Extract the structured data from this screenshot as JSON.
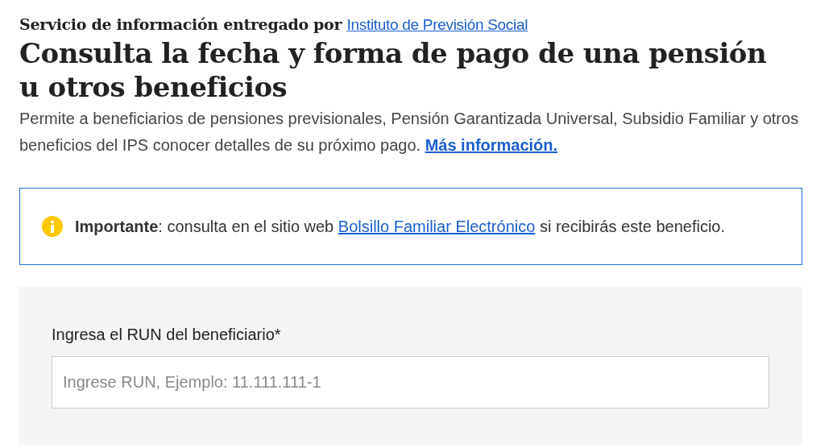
{
  "provider": {
    "text": "Servicio de información entregado por",
    "link": "Instituto de Previsión Social"
  },
  "title": "Consulta la fecha y forma de pago de una pensión u otros beneficios",
  "description": {
    "text": "Permite a beneficiarios de pensiones previsionales, Pensión Garantizada Universal, Subsidio Familiar y otros beneficios del IPS conocer detalles de su próximo pago.",
    "link": "Más información."
  },
  "notice": {
    "before": "**Importante**: consulta en el sitio web",
    "link": "Bolsillo Familiar Electrónico",
    "after": "si recibirás este beneficio."
  },
  "form": {
    "label": "Ingresa el RUN del beneficiario*",
    "placeholder": "Ingrese RUN, Ejemplo: 11.111.111-1"
  }
}
